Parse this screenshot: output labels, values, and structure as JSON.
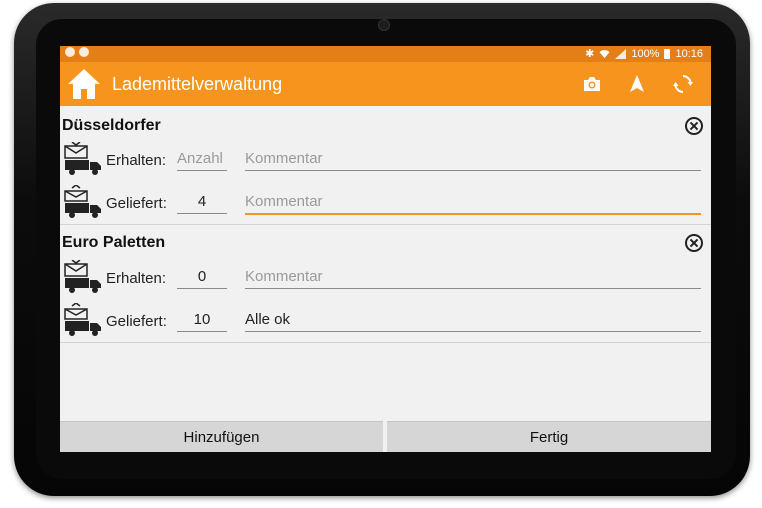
{
  "statusbar": {
    "battery": "100%",
    "time": "10:16",
    "icons": [
      "notification-icon",
      "notification-icon",
      "bluetooth-icon",
      "wifi-icon",
      "signal-icon",
      "battery-icon"
    ]
  },
  "toolbar": {
    "title": "Lademittelverwaltung",
    "icons": [
      "home-icon",
      "camera-icon",
      "navigation-icon",
      "sync-icon"
    ]
  },
  "colors": {
    "accent": "#f7941d",
    "statusbar": "#e47e16",
    "background": "#f1f1f1",
    "focus_underline": "#f7941d"
  },
  "sections": [
    {
      "title": "Düsseldorfer",
      "received": {
        "label": "Erhalten:",
        "qty_value": "",
        "qty_placeholder": "Anzahl",
        "comment_value": "",
        "comment_placeholder": "Kommentar"
      },
      "delivered": {
        "label": "Geliefert:",
        "qty_value": "4",
        "comment_value": "",
        "comment_placeholder": "Kommentar"
      }
    },
    {
      "title": "Euro Paletten",
      "received": {
        "label": "Erhalten:",
        "qty_value": "0",
        "comment_value": "",
        "comment_placeholder": "Kommentar"
      },
      "delivered": {
        "label": "Geliefert:",
        "qty_value": "10",
        "comment_value": "Alle ok"
      }
    }
  ],
  "buttons": {
    "add": "Hinzufügen",
    "done": "Fertig"
  }
}
